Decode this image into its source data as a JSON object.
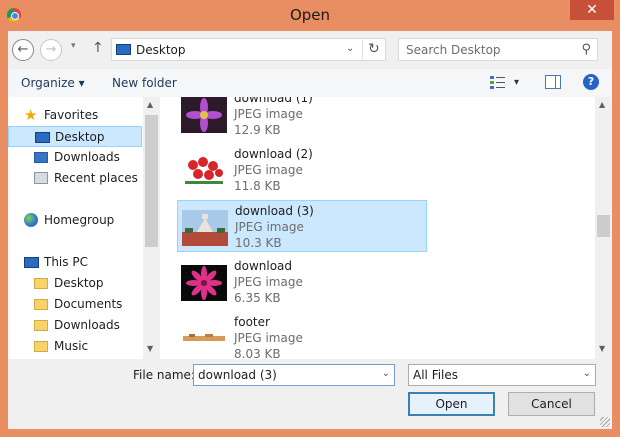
{
  "window": {
    "title": "Open",
    "close_glyph": "✕"
  },
  "nav": {
    "back_glyph": "←",
    "forward_glyph": "→",
    "recent_glyph": "▾",
    "up_glyph": "↑"
  },
  "address": {
    "location": "Desktop",
    "dropdown_glyph": "⌄",
    "refresh_glyph": "↻"
  },
  "search": {
    "placeholder": "Search Desktop",
    "icon_glyph": "⚲"
  },
  "toolbar": {
    "organize_label": "Organize ▾",
    "new_folder_label": "New folder",
    "view_dd_glyph": "▾",
    "help_glyph": "?"
  },
  "sidebar": {
    "favorites": "Favorites",
    "items": [
      {
        "label": "Desktop"
      },
      {
        "label": "Downloads"
      },
      {
        "label": "Recent places"
      }
    ],
    "homegroup": "Homegroup",
    "this_pc": "This PC",
    "pc_items": [
      {
        "label": "Desktop"
      },
      {
        "label": "Documents"
      },
      {
        "label": "Downloads"
      },
      {
        "label": "Music"
      }
    ]
  },
  "files": [
    {
      "name": "download (1)",
      "type": "JPEG image",
      "size": "12.9 KB"
    },
    {
      "name": "download (2)",
      "type": "JPEG image",
      "size": "11.8 KB"
    },
    {
      "name": "download (3)",
      "type": "JPEG image",
      "size": "10.3 KB"
    },
    {
      "name": "download",
      "type": "JPEG image",
      "size": "6.35 KB"
    },
    {
      "name": "footer",
      "type": "JPEG image",
      "size": "8.03 KB"
    }
  ],
  "footer": {
    "file_name_label": "File name:",
    "file_name_value": "download (3)",
    "filter_value": "All Files",
    "dropdown_glyph": "⌄",
    "open_label": "Open",
    "cancel_label": "Cancel"
  },
  "scroll": {
    "up_glyph": "▲",
    "down_glyph": "▼"
  },
  "colors": {
    "title_bar": "#e98d63",
    "selection": "#cce8ff",
    "selection_border": "#99d1ff"
  }
}
